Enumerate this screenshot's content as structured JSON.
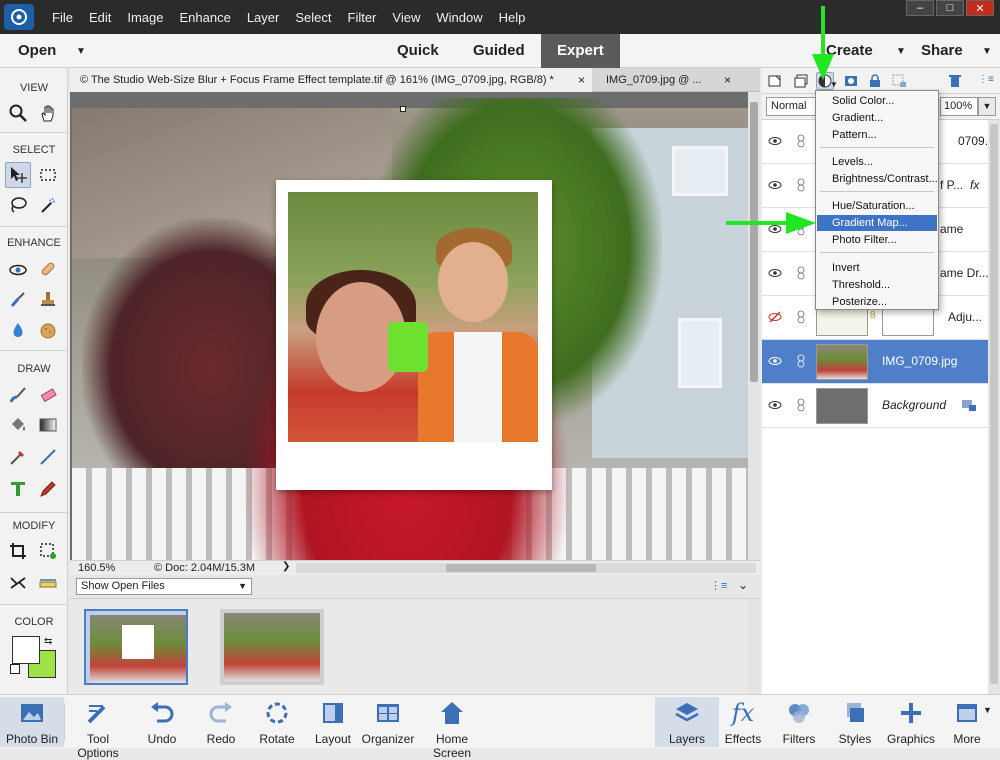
{
  "menubar": {
    "items": [
      "File",
      "Edit",
      "Image",
      "Enhance",
      "Layer",
      "Select",
      "Filter",
      "View",
      "Window",
      "Help"
    ],
    "window_controls": [
      "–",
      "□",
      "✕"
    ]
  },
  "modebar": {
    "open_label": "Open",
    "modes": [
      "Quick",
      "Guided",
      "Expert"
    ],
    "active_mode": "Expert",
    "create_label": "Create",
    "share_label": "Share"
  },
  "toolbox": {
    "sections": [
      "VIEW",
      "SELECT",
      "ENHANCE",
      "DRAW",
      "MODIFY",
      "COLOR"
    ],
    "colors": {
      "foreground": "#ffffff",
      "background": "#9ee246"
    }
  },
  "doc_tabs": [
    {
      "label": "© The Studio Web-Size Blur + Focus Frame Effect template.tif @ 161% (IMG_0709.jpg, RGB/8) *",
      "active": true
    },
    {
      "label": "IMG_0709.jpg @ ...",
      "active": false
    }
  ],
  "statusbar": {
    "zoom": "160.5%",
    "doc_info": "© Doc: 2.04M/15.3M",
    "scroll_grip": "'''"
  },
  "photo_bin": {
    "source_select": "Show Open Files"
  },
  "layers_panel": {
    "blend_mode": "Normal",
    "opacity": "100%",
    "layers": [
      {
        "name": "0709.jp...",
        "visible": true,
        "fx": false,
        "italic": false
      },
      {
        "name": "f P...",
        "visible": true,
        "fx": true,
        "italic": false
      },
      {
        "name": "ame",
        "visible": true,
        "fx": false,
        "italic": false
      },
      {
        "name": "ame Dr...",
        "visible": true,
        "fx": false,
        "italic": false
      },
      {
        "name": "Adju...",
        "visible": false,
        "fx": false,
        "italic": false
      },
      {
        "name": "IMG_0709.jpg",
        "visible": true,
        "fx": false,
        "italic": false,
        "selected": true
      },
      {
        "name": "Background",
        "visible": true,
        "fx": false,
        "italic": true
      }
    ],
    "fx_label": "fx"
  },
  "adjustment_menu": {
    "groups": [
      [
        "Solid Color...",
        "Gradient...",
        "Pattern..."
      ],
      [
        "Levels...",
        "Brightness/Contrast..."
      ],
      [
        "Hue/Saturation...",
        "Gradient Map...",
        "Photo Filter..."
      ],
      [
        "Invert",
        "Threshold...",
        "Posterize..."
      ]
    ],
    "highlighted": "Gradient Map..."
  },
  "taskbar": {
    "left": [
      "Photo Bin",
      "Tool Options",
      "Undo",
      "Redo",
      "Rotate",
      "Layout",
      "Organizer",
      "Home Screen"
    ],
    "right": [
      "Layers",
      "Effects",
      "Filters",
      "Styles",
      "Graphics",
      "More"
    ],
    "effects_glyph": "fx"
  },
  "annotation_color": "#22e622"
}
